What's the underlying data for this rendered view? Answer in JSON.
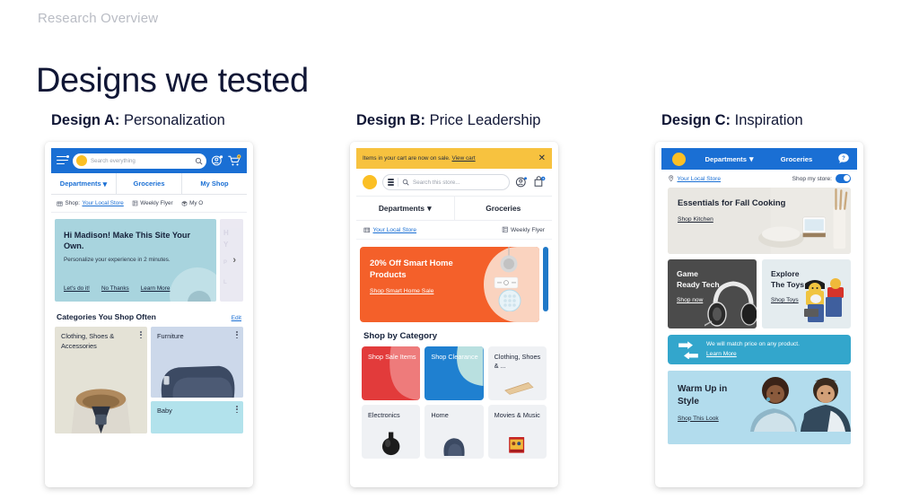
{
  "slide": {
    "eyebrow": "Research Overview",
    "title": "Designs we tested"
  },
  "colors": {
    "brand_blue": "#1a6fd4",
    "brand_yellow": "#fbbf24",
    "banner_yellow": "#f7c23f",
    "promo_orange": "#f4602a",
    "sale_red": "#e23b3b",
    "clearance_blue": "#1f80d0",
    "match_teal": "#33a6cc",
    "hero_teal": "#a8d4de",
    "warm_blue": "#b2dced"
  },
  "designs": [
    {
      "id": "a",
      "label": "Design A:",
      "name": "Personalization",
      "header": {
        "menu_icon": "hamburger-menu-icon",
        "search_placeholder": "Search everything",
        "search_icon": "search-icon",
        "account_icon": "account-icon",
        "cart_icon": "cart-icon",
        "cart_count": "4"
      },
      "nav": [
        {
          "label": "Departments",
          "caret": "⌄"
        },
        {
          "label": "Groceries"
        },
        {
          "label": "My Shop"
        }
      ],
      "subnav": [
        {
          "icon": "store-icon",
          "prefix": "Shop:",
          "link": "Your Local Store"
        },
        {
          "icon": "flyer-icon",
          "label": "Weekly Flyer"
        },
        {
          "icon": "box-icon",
          "label": "My O"
        }
      ],
      "hero": {
        "title": "Hi Madison! Make This Site Your Own.",
        "subtitle": "Personalize your experience in 2 minutes.",
        "actions": [
          "Let's do it!",
          "No Thanks",
          "Learn More"
        ],
        "next_icon": "chevron-right-icon",
        "peek_lines": [
          "H",
          "Y",
          "P",
          "L"
        ]
      },
      "categories": {
        "heading": "Categories You Shop Often",
        "edit_label": "Edit",
        "tiles": [
          {
            "label": "Clothing, Shoes & Accessories",
            "bg": "#e4e2d6",
            "image": "parka-coat-photo"
          },
          {
            "label": "Furniture",
            "bg": "#ccd8ea",
            "image": "bean-bag-chair-photo"
          },
          {
            "label": "Baby",
            "bg": "#b2e2ec",
            "image": ""
          }
        ]
      }
    },
    {
      "id": "b",
      "label": "Design B:",
      "name": "Price Leadership",
      "banner": {
        "text": "Items in your cart are now on sale.",
        "link": "View cart",
        "close_icon": "close-icon"
      },
      "header": {
        "logo": "yellow-circle-logo",
        "menu_icon": "list-menu-icon",
        "search_icon": "search-icon",
        "search_placeholder": "Search this store...",
        "account_icon": "account-icon",
        "cart_icon": "cart-icon",
        "cart_count": "4"
      },
      "nav": [
        {
          "label": "Departments",
          "caret": "⌄"
        },
        {
          "label": "Groceries"
        }
      ],
      "subnav": [
        {
          "icon": "store-icon",
          "link": "Your Local Store"
        },
        {
          "icon": "flyer-icon",
          "label": "Weekly Flyer"
        }
      ],
      "hero": {
        "title": "20% Off Smart Home Products",
        "link": "Shop Smart Home Sale",
        "image": "smart-speaker-and-outlet-photo"
      },
      "section_heading": "Shop by Category",
      "tiles": [
        {
          "label": "Shop Sale Items",
          "bg": "#e23b3b",
          "text": "#ffffff",
          "image": ""
        },
        {
          "label": "Shop Clearance",
          "bg": "#1f80d0",
          "text": "#ffffff",
          "image": ""
        },
        {
          "label": "Clothing, Shoes & ...",
          "bg": "#eff1f4",
          "text": "#20283a",
          "image": "handbag-photo"
        },
        {
          "label": "Electronics",
          "bg": "#eff1f4",
          "text": "#20283a",
          "image": "speaker-photo"
        },
        {
          "label": "Home",
          "bg": "#eff1f4",
          "text": "#20283a",
          "image": "bean-bag-photo"
        },
        {
          "label": "Movies & Music",
          "bg": "#eff1f4",
          "text": "#20283a",
          "image": "dvd-case-photo"
        }
      ]
    },
    {
      "id": "c",
      "label": "Design C:",
      "name": "Inspiration",
      "header": {
        "logo": "yellow-circle-logo",
        "items": [
          {
            "label": "Departments",
            "caret": "⌄"
          },
          {
            "label": "Groceries"
          }
        ],
        "help_icon": "help-bubble-icon"
      },
      "subnav": {
        "pin_icon": "location-pin-icon",
        "store_link": "Your Local Store",
        "toggle_label": "Shop my store:",
        "toggle_on": true
      },
      "hero": {
        "title": "Essentials for Fall Cooking",
        "link": "Shop Kitchen",
        "image": "kitchen-utensils-photo"
      },
      "cards": [
        {
          "title": "Game Ready Tech",
          "link": "Shop now",
          "theme": "dark",
          "image": "gaming-headset-photo"
        },
        {
          "title": "Explore The Toys",
          "link": "Shop Toys",
          "theme": "light",
          "image": "lego-figures-photo"
        }
      ],
      "match": {
        "icon": "price-match-arrows-icon",
        "text": "We will match price on any product.",
        "link": "Learn More"
      },
      "warm": {
        "title": "Warm Up in Style",
        "link": "Shop This Look",
        "image": "couple-in-sweaters-photo"
      }
    }
  ]
}
